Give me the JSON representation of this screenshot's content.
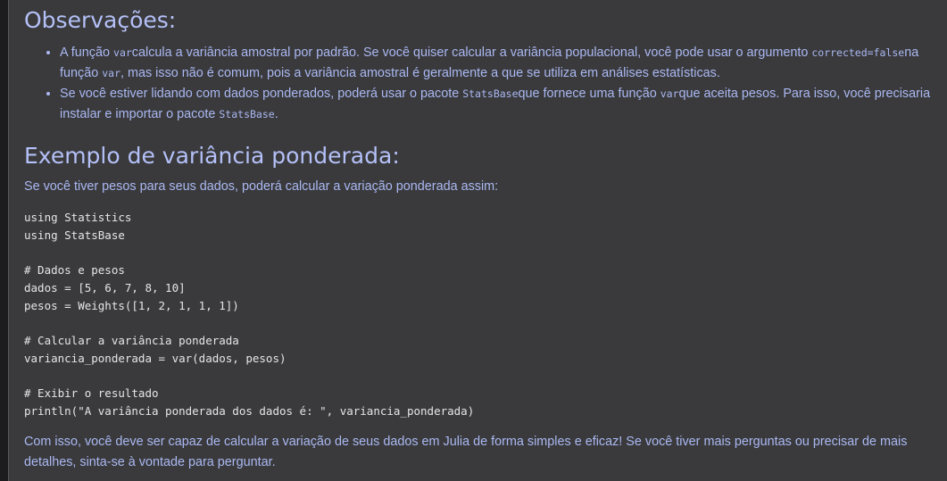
{
  "section1": {
    "heading": "Observações:",
    "bullet1": {
      "t1": "A função ",
      "c1": "var",
      "t2": "calcula a variância amostral por padrão. Se você quiser calcular a variância populacional, você pode usar o argumento ",
      "c2": "corrected=false",
      "t3": "na função ",
      "c3": "var",
      "t4": ", mas isso não é comum, pois a variância amostral é geralmente a que se utiliza em análises estatísticas."
    },
    "bullet2": {
      "t1": "Se você estiver lidando com dados ponderados, poderá usar o pacote ",
      "c1": "StatsBase",
      "t2": "que fornece uma função ",
      "c2": "var",
      "t3": "que aceita pesos. Para isso, você precisaria instalar e importar o pacote ",
      "c3": "StatsBase",
      "t4": "."
    }
  },
  "section2": {
    "heading": "Exemplo de variância ponderada:",
    "intro": "Se você tiver pesos para seus dados, poderá calcular a variação ponderada assim:",
    "code": "using Statistics\nusing StatsBase\n\n# Dados e pesos\ndados = [5, 6, 7, 8, 10]\npesos = Weights([1, 2, 1, 1, 1])\n\n# Calcular a variância ponderada\nvariancia_ponderada = var(dados, pesos)\n\n# Exibir o resultado\nprintln(\"A variância ponderada dos dados é: \", variancia_ponderada)",
    "outro": "Com isso, você deve ser capaz de calcular a variação de seus dados em Julia de forma simples e eficaz! Se você tiver mais perguntas ou precisar de mais detalhes, sinta-se à vontade para perguntar."
  }
}
